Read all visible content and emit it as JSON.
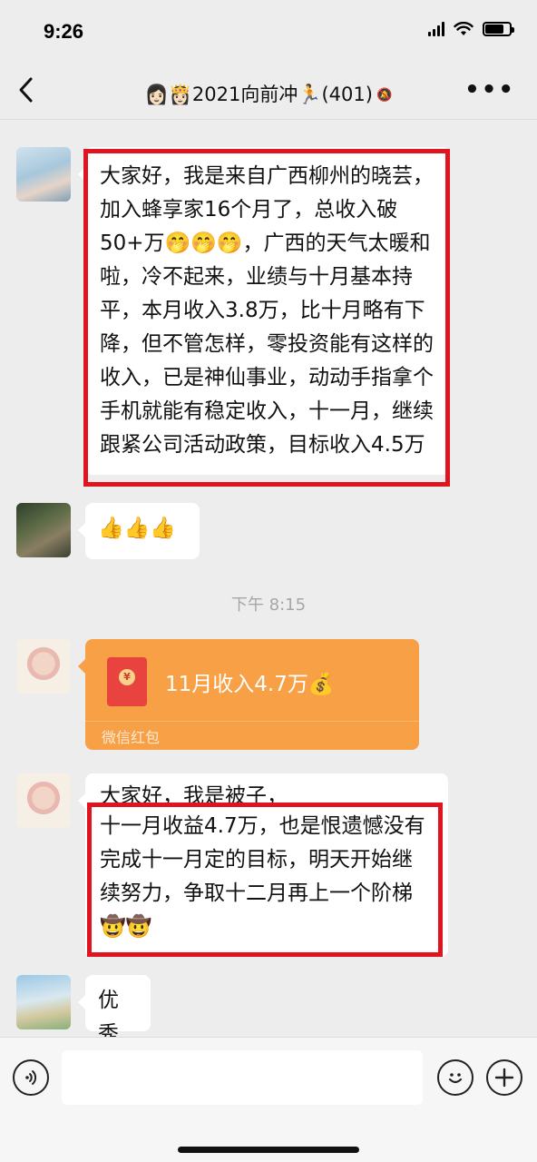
{
  "status_bar": {
    "time": "9:26"
  },
  "header": {
    "back_label": "<",
    "title": "👩🏻👸🏻2021向前冲🏃(401)",
    "mute_icon": "🔕",
    "more_label": "•••"
  },
  "messages": [
    {
      "type": "text",
      "avatar": "avatar-1",
      "text": "大家好，我是来自广西柳州的晓芸，加入蜂享家16个月了，总收入破50+万🤭🤭🤭，广西的天气太暖和啦，冷不起来，业绩与十月基本持平，本月收入3.8万，比十月略有下降，但不管怎样，零投资能有这样的收入，已是神仙事业，动动手指拿个手机就能有稳定收入，十一月，继续跟紧公司活动政策，目标收入4.5万"
    },
    {
      "type": "text",
      "avatar": "avatar-2",
      "text": "👍👍👍"
    },
    {
      "type": "time",
      "text": "下午 8:15"
    },
    {
      "type": "red_packet",
      "avatar": "avatar-3",
      "title": "11月收入4.7万💰",
      "footer": "微信红包"
    },
    {
      "type": "text",
      "avatar": "avatar-3",
      "line1": "大家好，我是被子，",
      "text": "十一月收益4.7万，也是恨遗憾没有完成十一月定的目标，明天开始继续努力，争取十二月再上一个阶梯🤠🤠"
    },
    {
      "type": "text",
      "avatar": "avatar-4",
      "text": "优秀"
    }
  ],
  "input_bar": {
    "voice_icon": "voice-icon",
    "emoji_icon": "emoji-icon",
    "plus_icon": "plus-icon"
  },
  "colors": {
    "background": "#ededed",
    "bubble": "#ffffff",
    "red_packet": "#f7a046",
    "highlight": "#e0141e"
  }
}
